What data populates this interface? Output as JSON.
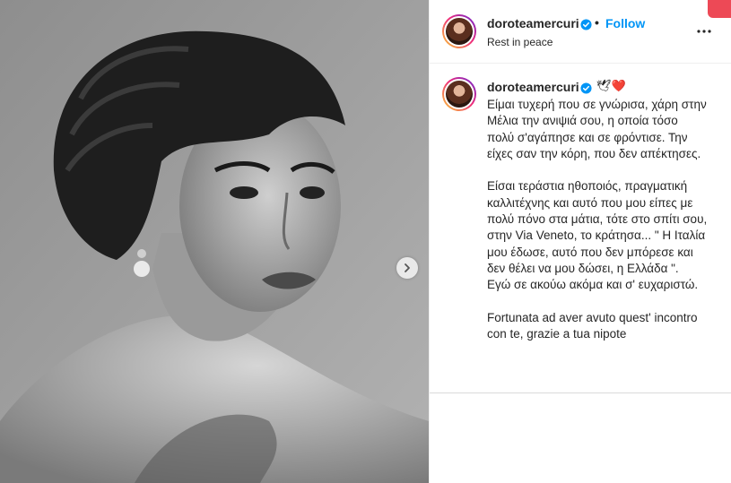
{
  "post": {
    "author": "doroteamercuri",
    "verified": true,
    "follow_label": "Follow",
    "separator": "•",
    "location_caption": "Rest in peace",
    "caption_emoji": "🕊❤️",
    "caption_text": "Είμαι τυχερή που σε γνώρισα, χάρη στην Μέλια την ανιψιά σου, η οποία τόσο πολύ σ'αγάπησε και σε φρόντισε. Την είχες σαν την κόρη, που δεν απέκτησες.\n\nΕίσαι τεράστια ηθοποιός, πραγματική καλλιτέχνης και αυτό που μου είπες με πολύ πόνο στα μάτια, τότε στο σπίτι σου, στην Via Veneto, το κράτησα... \" Η Ιταλία μου έδωσε, αυτό που δεν μπόρεσε και δεν θέλει να μου δώσει, η Ελλάδα \".\nΕγώ σε ακούω ακόμα και σ' ευχαριστώ.\n\nFortunata ad aver avuto quest' incontro con te, grazie a tua nipote"
  },
  "icons": {
    "verified": "verified-badge-icon",
    "more": "more-options-icon",
    "next": "chevron-right-icon"
  },
  "colors": {
    "link": "#0095f6",
    "verified": "#0095f6",
    "text": "#262626",
    "border": "#efefef"
  }
}
